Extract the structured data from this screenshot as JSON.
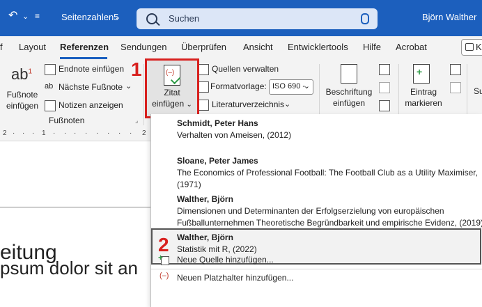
{
  "titlebar": {
    "doc_name": "Seitenzahlen5",
    "search_placeholder": "Suchen",
    "user": "Björn Walther"
  },
  "tabs": [
    "f",
    "Layout",
    "Referenzen",
    "Sendungen",
    "Überprüfen",
    "Ansicht",
    "Entwicklertools",
    "Hilfe",
    "Acrobat"
  ],
  "share_label": "K",
  "ribbon": {
    "footnote_group": {
      "insert_footnote_line1": "Fußnote",
      "insert_footnote_line2": "einfügen",
      "endnote": "Endnote einfügen",
      "next_footnote": "Nächste Fußnote",
      "show_notes": "Notizen anzeigen",
      "group_label": "Fußnoten"
    },
    "citation": {
      "insert_line1": "Zitat",
      "insert_line2": "einfügen",
      "manage_sources": "Quellen verwalten",
      "style_label": "Formatvorlage:",
      "style_value": "ISO 690 -",
      "bibliography": "Literaturverzeichnis"
    },
    "caption_line1": "Beschriftung",
    "caption_line2": "einfügen",
    "mark_line1": "Eintrag",
    "mark_line2": "markieren",
    "cut_label": "Su"
  },
  "markers": {
    "first": "1",
    "second": "2"
  },
  "ruler": [
    "2",
    "1",
    "2"
  ],
  "document": {
    "heading_fragment": "eitung",
    "body_fragment": "psum dolor sit an"
  },
  "citations": [
    {
      "author": "Schmidt, Peter Hans",
      "lines": [
        "Verhalten von Ameisen, (2012)"
      ]
    },
    {
      "author": "Sloane, Peter James",
      "lines": [
        "The Economics of Professional Football: The Football Club as a Utility Maximiser,",
        "(1971)"
      ]
    },
    {
      "author": "Walther, Björn",
      "lines": [
        "Dimensionen und Determinanten der Erfolgserzielung von europäischen",
        "Fußballunternehmen Theoretische Begründbarkeit und empirische Evidenz, (2019)"
      ]
    },
    {
      "author": "Walther, Björn",
      "lines": [
        "Statistik mit R, (2022)"
      ]
    }
  ],
  "actions": {
    "new_source": "Neue Quelle hinzufügen...",
    "new_placeholder": "Neuen Platzhalter hinzufügen..."
  }
}
